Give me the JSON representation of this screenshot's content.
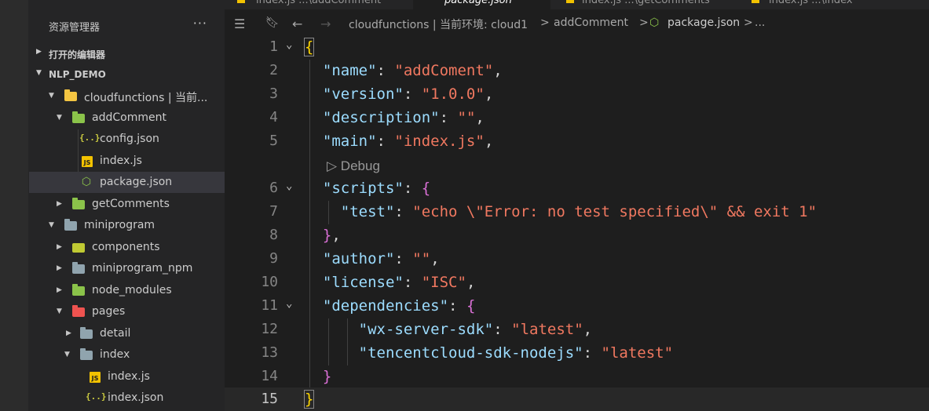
{
  "sidebar": {
    "title": "资源管理器",
    "more": "···",
    "open_editors": "打开的编辑器",
    "project": "NLP_DEMO",
    "tree": [
      {
        "label": "cloudfunctions | 当前...",
        "icon": "folder-yellow-icon"
      },
      {
        "label": "addComment",
        "icon": "folder-green-icon"
      },
      {
        "label": "config.json",
        "icon": "json-icon"
      },
      {
        "label": "index.js",
        "icon": "js-icon"
      },
      {
        "label": "package.json",
        "icon": "node-icon"
      },
      {
        "label": "getComments",
        "icon": "folder-green-icon"
      },
      {
        "label": "miniprogram",
        "icon": "folder-icon"
      },
      {
        "label": "components",
        "icon": "components-folder-icon"
      },
      {
        "label": "miniprogram_npm",
        "icon": "folder-icon"
      },
      {
        "label": "node_modules",
        "icon": "folder-green-icon"
      },
      {
        "label": "pages",
        "icon": "folder-red-icon"
      },
      {
        "label": "detail",
        "icon": "folder-icon"
      },
      {
        "label": "index",
        "icon": "folder-icon"
      },
      {
        "label": "index.js",
        "icon": "js-icon"
      },
      {
        "label": "index.json",
        "icon": "json-icon"
      }
    ]
  },
  "tabs": [
    {
      "label": "index.js  ...\\addComment"
    },
    {
      "label": "package.json"
    },
    {
      "label": "index.js  ...\\getComments"
    },
    {
      "label": "index.js  ...\\index"
    }
  ],
  "breadcrumb": {
    "path1": "cloudfunctions | 当前环境: cloud1",
    "sep": ">",
    "path2": "addComment",
    "file": "package.json",
    "tail": "..."
  },
  "editor": {
    "codelens": "Debug",
    "line_numbers": [
      "1",
      "2",
      "3",
      "4",
      "5",
      "6",
      "7",
      "8",
      "9",
      "10",
      "11",
      "12",
      "13",
      "14",
      "15"
    ],
    "tokens": {
      "name_k": "\"name\"",
      "name_v": "\"addComent\"",
      "version_k": "\"version\"",
      "version_v": "\"1.0.0\"",
      "description_k": "\"description\"",
      "description_v": "\"\"",
      "main_k": "\"main\"",
      "main_v": "\"index.js\"",
      "scripts_k": "\"scripts\"",
      "test_k": "\"test\"",
      "test_v": "\"echo \\\"Error: no test specified\\\" && exit 1\"",
      "author_k": "\"author\"",
      "author_v": "\"\"",
      "license_k": "\"license\"",
      "license_v": "\"ISC\"",
      "dependencies_k": "\"dependencies\"",
      "dep1_k": "\"wx-server-sdk\"",
      "dep1_v": "\"latest\"",
      "dep2_k": "\"tencentcloud-sdk-nodejs\"",
      "dep2_v": "\"latest\""
    }
  }
}
